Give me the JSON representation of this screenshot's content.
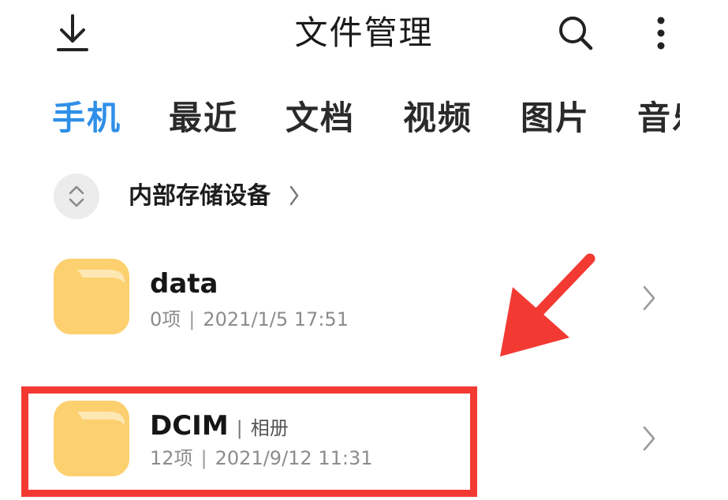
{
  "header": {
    "title": "文件管理",
    "download_icon": "download-icon",
    "search_icon": "search-icon",
    "more_icon": "more-vertical-icon"
  },
  "tabs": [
    {
      "label": "手机",
      "active": true
    },
    {
      "label": "最近",
      "active": false
    },
    {
      "label": "文档",
      "active": false
    },
    {
      "label": "视频",
      "active": false
    },
    {
      "label": "图片",
      "active": false
    },
    {
      "label": "音乐",
      "active": false
    }
  ],
  "breadcrumb": {
    "label": "内部存储设备",
    "toggle_icon": "expand-collapse-icon",
    "chevron_icon": "chevron-right-icon"
  },
  "files": [
    {
      "name": "data",
      "tag": "",
      "count": "0项",
      "date": "2021/1/5 17:51"
    },
    {
      "name": "DCIM",
      "tag": "相册",
      "count": "12项",
      "date": "2021/9/12 11:31"
    }
  ],
  "colors": {
    "accent": "#2f8fe8",
    "folder": "#fdd06f",
    "folder_tab": "#fde7b3",
    "annotation": "#f23a33"
  }
}
